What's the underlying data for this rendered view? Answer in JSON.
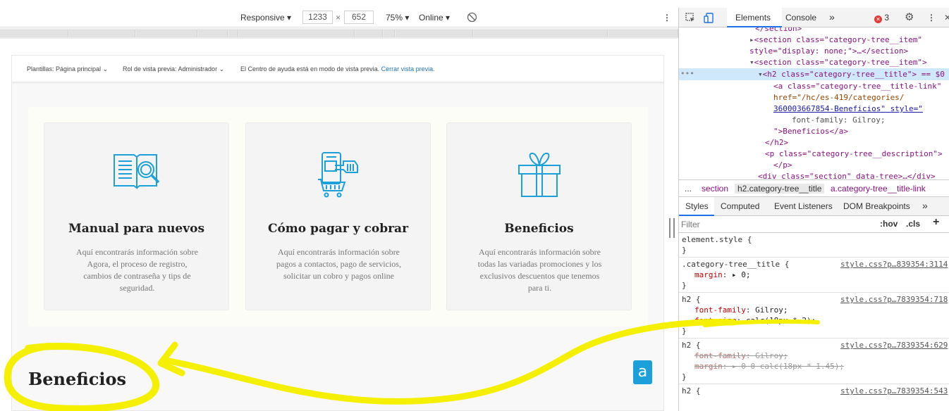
{
  "emulation": {
    "device": "Responsive",
    "width": "1233",
    "times": "×",
    "height": "652",
    "zoom": "75%",
    "network": "Online",
    "more": "⋮"
  },
  "preview_bar": {
    "templates": "Plantillas: Página principal",
    "role": "Rol de vista previa: Administrador",
    "help_text": "El Centro de ayuda está en modo de vista previa.",
    "close_link": "Cerrar vista previa."
  },
  "categories": [
    {
      "title": "Manual para nuevos",
      "description": "Aquí encontrarás información sobre Agora, el proceso de registro, cambios de contraseña y tips de seguridad.",
      "icon": "manual-book-icon"
    },
    {
      "title": "Cómo pagar y cobrar",
      "description": "Aquí encontrarás información sobre pagos a contactos, pago de servicios, solicitar un cobro y pagos online",
      "icon": "payment-phone-icon"
    },
    {
      "title": "Beneficios",
      "description": "Aquí encontrarás información sobre todas las variadas promociones y los exclusivos descuentos que tenemos para ti.",
      "icon": "gift-icon"
    }
  ],
  "section_title": "Beneficios",
  "widget_letter": "a",
  "devtools": {
    "tabs": {
      "elements": "Elements",
      "console": "Console",
      "more": "»",
      "error_count": "3"
    },
    "dom_lines": [
      "</section>",
      "<section class=\"category-tree__item\"",
      "style=\"display: none;\">…</section>",
      "<section class=\"category-tree__item\">",
      "<h2 class=\"category-tree__title\"> == $0",
      "<a class=\"category-tree__title-link\"",
      "href=\"/hc/es-419/categories/",
      "360003667854-Beneficios\" style=\"",
      "font-family: Gilroy;",
      "\">Beneficios</a>",
      "</h2>",
      "<p class=\"category-tree__description\">",
      "</p>",
      "<div class=\"section\" data-tree>…</div>"
    ],
    "selected_marker": "•••",
    "breadcrumbs": [
      "...",
      "section",
      "h2.category-tree__title",
      "a.category-tree__title-link"
    ],
    "subtabs": [
      "Styles",
      "Computed",
      "Event Listeners",
      "DOM Breakpoints",
      "»"
    ],
    "filter_placeholder": "Filter",
    "filter_hov": ":hov",
    "filter_cls": ".cls",
    "filter_add": "+",
    "rules": {
      "element_style": "element.style {",
      "close": "}",
      "r1_selector": ".category-tree__title {",
      "r1_src": "style.css?p…839354:3114",
      "r1_prop": "margin",
      "r1_val": "▸ 0;",
      "r2_selector": "h2 {",
      "r2_src": "style.css?p…7839354:718",
      "r2_p1": "font-family",
      "r2_v1": "Gilroy;",
      "r2_p2": "font-size",
      "r2_v2": "calc(18px * 2);",
      "r3_selector": "h2 {",
      "r3_src": "style.css?p…7839354:629",
      "r3_p1": "font-family",
      "r3_v1": "Gilroy;",
      "r3_p2": "margin",
      "r3_v2": "▸ 0 0 calc(18px * 1.45);",
      "r4_selector": "h2 {",
      "r4_src": "style.css?p…7839354:543"
    }
  },
  "colors": {
    "accent_cyan": "#1ba0d9",
    "annotation_yellow": "#f5f000",
    "devtools_blue": "#1a73e8"
  }
}
